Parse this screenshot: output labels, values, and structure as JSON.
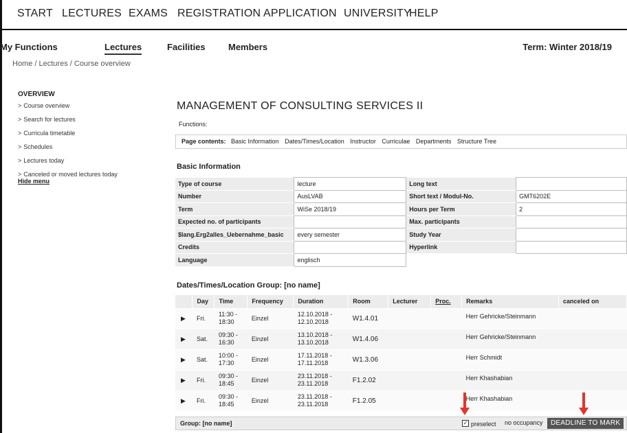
{
  "topnav": [
    "START",
    "LECTURES",
    "EXAMS",
    "REGISTRATION",
    "APPLICATION",
    "UNIVERSITY",
    "HELP"
  ],
  "subnav": {
    "items": [
      "My Functions",
      "Lectures",
      "Facilities",
      "Members"
    ],
    "active": "Lectures",
    "term": "Term: Winter 2018/19"
  },
  "breadcrumb": "Home  / Lectures / Course overview",
  "sidebar": {
    "heading": "OVERVIEW",
    "links": [
      "Course overview",
      "Search for lectures",
      "Curricula timetable",
      "Schedules",
      "Lectures today",
      "Canceled or moved lectures today"
    ],
    "hide": "Hide menu"
  },
  "course": {
    "title": "MANAGEMENT OF CONSULTING SERVICES II",
    "functions_label": "Functions:"
  },
  "page_contents": {
    "label": "Page contents:",
    "links": [
      "Basic Information",
      "Dates/Times/Location",
      "Instructor",
      "Curriculae",
      "Departments",
      "Structure Tree"
    ]
  },
  "basic_info": {
    "title": "Basic Information",
    "rows": [
      {
        "l1": "Type of course",
        "v1": "lecture",
        "l2": "Long text",
        "v2": ""
      },
      {
        "l1": "Number",
        "v1": "AusLVAB",
        "l2": "Short text / Modul-No.",
        "v2": "GMT6202E"
      },
      {
        "l1": "Term",
        "v1": "WiSe 2018/19",
        "l2": "Hours per Term",
        "v2": "2"
      },
      {
        "l1": "Expected no. of participants",
        "v1": "",
        "l2": "Max. participants",
        "v2": ""
      },
      {
        "l1": "$lang.Erg2alles_Uebernahme_basic",
        "v1": "every semester",
        "l2": "Study Year",
        "v2": ""
      },
      {
        "l1": "Credits",
        "v1": "",
        "l2": "Hyperlink",
        "v2": ""
      },
      {
        "l1": "Language",
        "v1": "englisch"
      }
    ]
  },
  "dates": {
    "title": "Dates/Times/Location Group: [no name]",
    "headers": [
      "",
      "Day",
      "Time",
      "Frequency",
      "Duration",
      "Room",
      "Lecturer",
      "Proc.",
      "Remarks",
      "canceled on"
    ],
    "rows": [
      {
        "day": "Fri.",
        "time": "11:30 - 18:30",
        "freq": "Einzel",
        "duration": "12.10.2018 - 12.10.2018",
        "room": "W1.4.01",
        "remarks": "Herr Gehricke/Steinmann"
      },
      {
        "day": "Sat.",
        "time": "09:30 - 16:30",
        "freq": "Einzel",
        "duration": "13.10.2018 - 13.10.2018",
        "room": "W1.4.06",
        "remarks": "Herr Gehricke/Steinmann"
      },
      {
        "day": "Sat.",
        "time": "10:00 - 17:30",
        "freq": "Einzel",
        "duration": "17.11.2018 - 17.11.2018",
        "room": "W1.3.06",
        "remarks": "Herr Schmidt"
      },
      {
        "day": "Fri.",
        "time": "09:30 - 18:45",
        "freq": "Einzel",
        "duration": "23.11.2018 - 23.11.2018",
        "room": "F1.2.02",
        "remarks": "Herr Khashabian"
      },
      {
        "day": "Fri.",
        "time": "09:30 - 18:45",
        "freq": "Einzel",
        "duration": "23.11.2018 - 23.11.2018",
        "room": "F1.2.05",
        "remarks": "Herr Khashabian"
      }
    ]
  },
  "footer": {
    "group_label": "Group: [no name]",
    "preselect": "preselect",
    "checkbox_mark": "✓",
    "no_occupancy": "no occupancy",
    "deadline": "DEADLINE TO MARK"
  },
  "colors": {
    "annotation_arrow": "#e8332a",
    "deadline_bg": "#555555"
  }
}
